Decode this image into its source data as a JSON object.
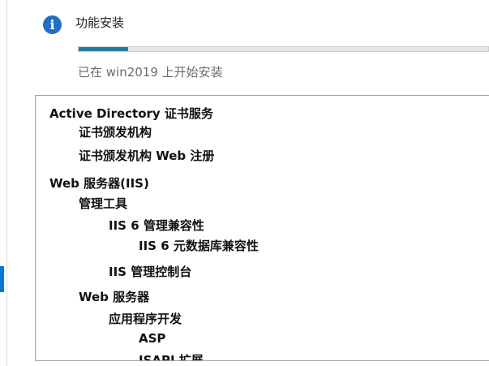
{
  "status": {
    "icon": "info-icon",
    "icon_glyph": "i",
    "title": "功能安装",
    "progress": 0.12,
    "subtitle": "已在 win2019 上开始安装"
  },
  "features": [
    {
      "label": "Active Directory 证书服务",
      "level": 0
    },
    {
      "label": "证书颁发机构",
      "level": 1
    },
    {
      "label": "证书颁发机构 Web 注册",
      "level": 1
    },
    {
      "label": "Web 服务器(IIS)",
      "level": 0
    },
    {
      "label": "管理工具",
      "level": 1
    },
    {
      "label": "IIS 6 管理兼容性",
      "level": 2
    },
    {
      "label": "IIS 6 元数据库兼容性",
      "level": 3
    },
    {
      "label": "IIS 管理控制台",
      "level": 2
    },
    {
      "label": "Web 服务器",
      "level": 1
    },
    {
      "label": "应用程序开发",
      "level": 2
    },
    {
      "label": "ASP",
      "level": 3
    },
    {
      "label": "ISAPI 扩展",
      "level": 3
    }
  ]
}
